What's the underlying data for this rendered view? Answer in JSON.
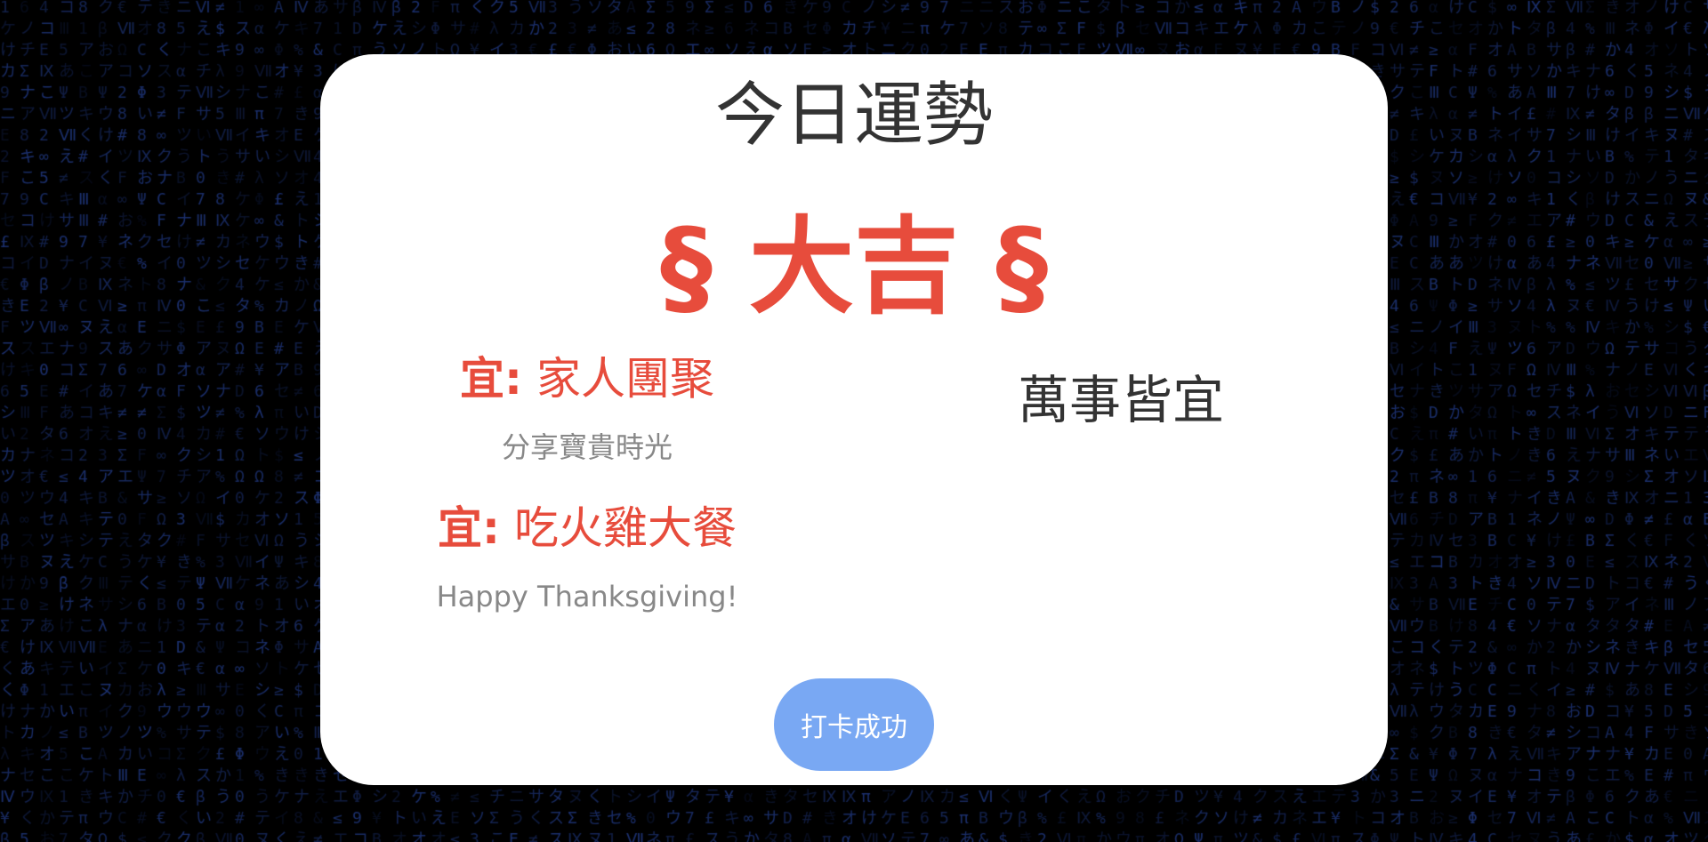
{
  "title": "今日運勢",
  "fortune": "§ 大吉 §",
  "suitable_items": [
    {
      "label": "宜:",
      "activity": "家人團聚",
      "description": "分享寶貴時光"
    },
    {
      "label": "宜:",
      "activity": "吃火雞大餐",
      "description": "Happy Thanksgiving!"
    }
  ],
  "right_text": "萬事皆宜",
  "checkin_button": "打卡成功",
  "colors": {
    "accent": "#e74c3c",
    "button": "#79a8f3",
    "background": "#000000",
    "matrix_glyph": "#1f3a8a"
  }
}
